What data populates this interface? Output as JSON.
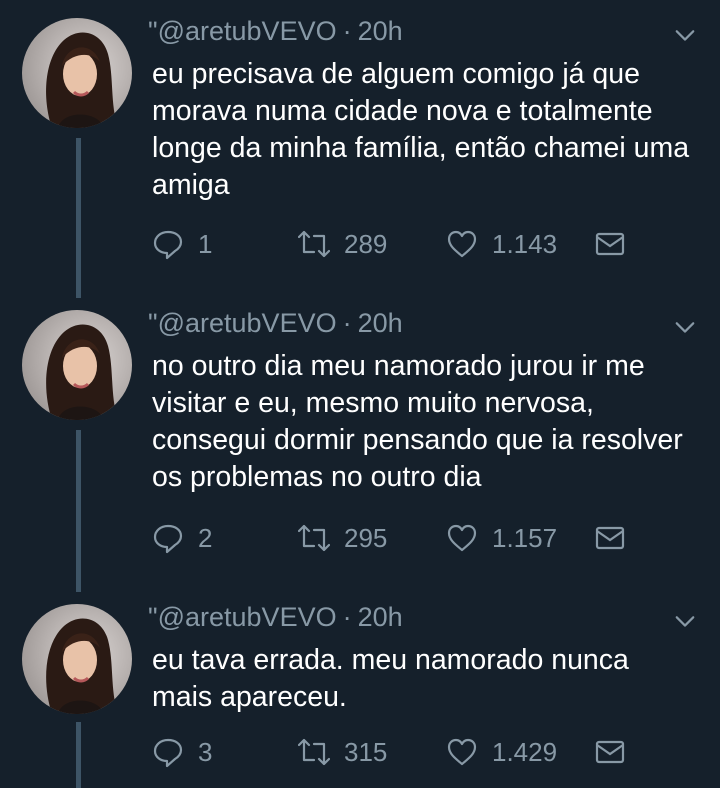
{
  "tweets": [
    {
      "handle_prefix": "ʺ",
      "handle": "@aretubVEVO",
      "separator": "·",
      "time": "20h",
      "text": "eu precisava de alguem comigo já que morava numa cidade nova e totalmente longe da minha família, então chamei uma amiga",
      "replies": "1",
      "retweets": "289",
      "likes": "1.143"
    },
    {
      "handle_prefix": "ʺ",
      "handle": "@aretubVEVO",
      "separator": "·",
      "time": "20h",
      "text": "no outro dia meu namorado jurou ir me visitar e eu, mesmo muito nervosa, consegui dormir pensando que ia resolver os problemas no outro dia",
      "replies": "2",
      "retweets": "295",
      "likes": "1.157"
    },
    {
      "handle_prefix": "ʺ",
      "handle": "@aretubVEVO",
      "separator": "·",
      "time": "20h",
      "text": "eu tava errada. meu namorado nunca mais apareceu.",
      "replies": "3",
      "retweets": "315",
      "likes": "1.429"
    }
  ],
  "colors": {
    "background": "#15202b",
    "secondary_text": "#8899a6",
    "thread_line": "#3d5466",
    "primary_text": "#ffffff"
  },
  "icons": [
    "avatar",
    "chevron-down-icon",
    "reply-icon",
    "retweet-icon",
    "like-icon",
    "direct-message-icon"
  ]
}
